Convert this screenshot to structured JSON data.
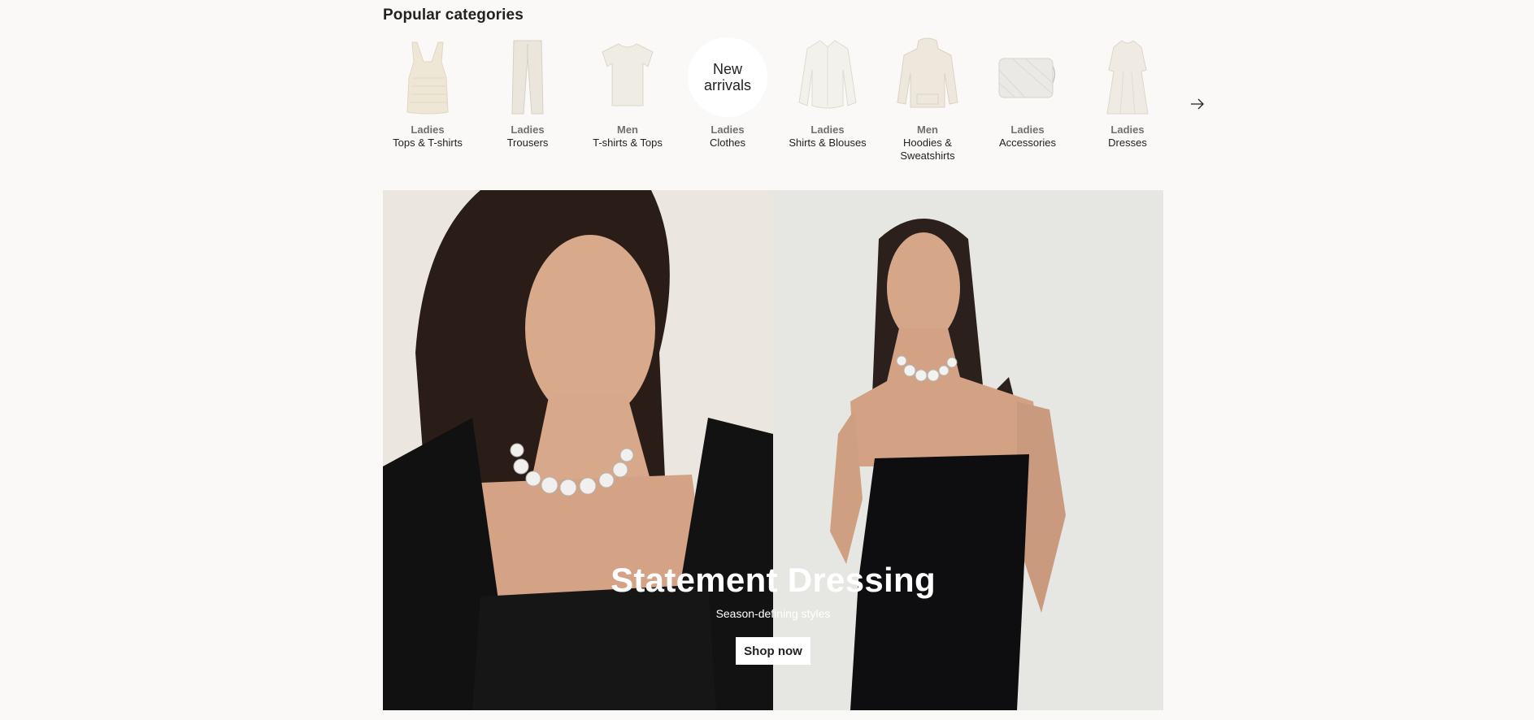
{
  "popular": {
    "title": "Popular categories",
    "categories": [
      {
        "top": "Ladies",
        "bottom": "Tops & T-shirts",
        "icon": "knit-tank-top-image"
      },
      {
        "top": "Ladies",
        "bottom": "Trousers",
        "icon": "trousers-image"
      },
      {
        "top": "Men",
        "bottom": "T-shirts & Tops",
        "icon": "tshirt-image"
      },
      {
        "top": "Ladies",
        "bottom": "Clothes",
        "circle_text_1": "New",
        "circle_text_2": "arrivals"
      },
      {
        "top": "Ladies",
        "bottom": "Shirts & Blouses",
        "icon": "blouse-image"
      },
      {
        "top": "Men",
        "bottom": "Hoodies &",
        "bottom2": "Sweatshirts",
        "icon": "hoodie-image"
      },
      {
        "top": "Ladies",
        "bottom": "Accessories",
        "icon": "bag-image"
      },
      {
        "top": "Ladies",
        "bottom": "Dresses",
        "icon": "dress-image"
      }
    ],
    "next_icon": "arrow-right-icon"
  },
  "hero": {
    "title": "Statement Dressing",
    "subtitle": "Season-defining styles",
    "cta": "Shop now"
  }
}
